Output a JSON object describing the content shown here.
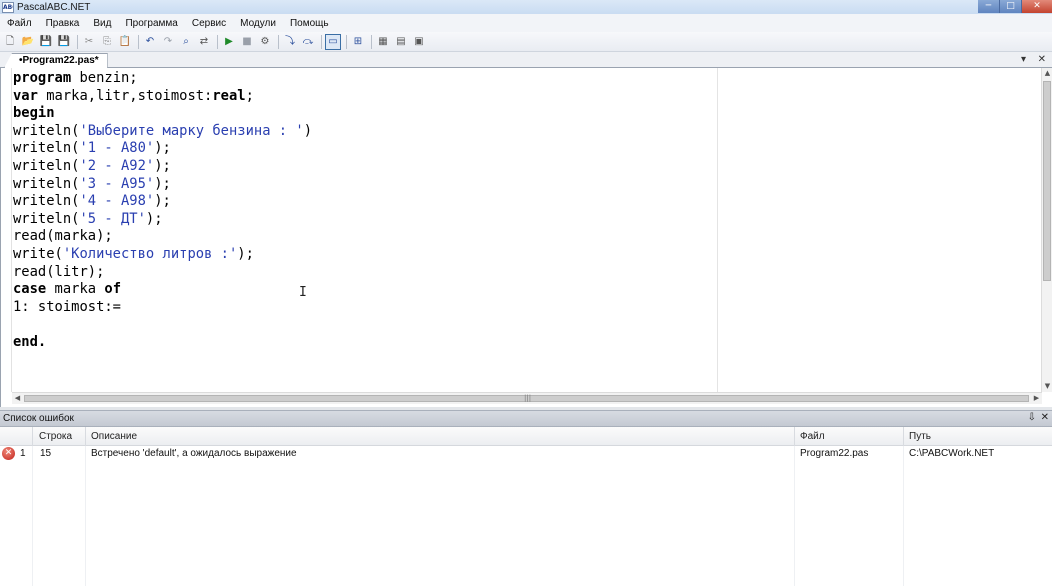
{
  "window": {
    "title": "PascalABC.NET",
    "icon_label": "ABC",
    "controls": {
      "minimize": "─",
      "maximize": "□",
      "close": "✕"
    }
  },
  "menu": {
    "items": [
      {
        "label": "Файл"
      },
      {
        "label": "Правка"
      },
      {
        "label": "Вид"
      },
      {
        "label": "Программа"
      },
      {
        "label": "Сервис"
      },
      {
        "label": "Модули"
      },
      {
        "label": "Помощь"
      }
    ]
  },
  "toolbar": {
    "icons": [
      {
        "name": "new-file-icon",
        "glyph": "🗋",
        "color": "#555555"
      },
      {
        "name": "open-file-icon",
        "glyph": "📂",
        "color": "#c9a030"
      },
      {
        "name": "save-icon",
        "glyph": "💾",
        "color": "#2b4f9c"
      },
      {
        "name": "save-all-icon",
        "glyph": "💾",
        "color": "#2b4f9c"
      },
      {
        "name": "sep"
      },
      {
        "name": "cut-icon",
        "glyph": "✂",
        "color": "#8a8a8a"
      },
      {
        "name": "copy-icon",
        "glyph": "⎘",
        "color": "#8a8a8a"
      },
      {
        "name": "paste-icon",
        "glyph": "📋",
        "color": "#b8862e"
      },
      {
        "name": "sep"
      },
      {
        "name": "undo-icon",
        "glyph": "↶",
        "color": "#2b4f9c"
      },
      {
        "name": "redo-icon",
        "glyph": "↷",
        "color": "#9aa0aa"
      },
      {
        "name": "find-icon",
        "glyph": "⌕",
        "color": "#2b4f9c"
      },
      {
        "name": "replace-icon",
        "glyph": "⇄",
        "color": "#555555"
      },
      {
        "name": "sep"
      },
      {
        "name": "run-icon",
        "glyph": "▶",
        "color": "#1f8a2a"
      },
      {
        "name": "stop-icon",
        "glyph": "■",
        "color": "#9aa0aa"
      },
      {
        "name": "compile-icon",
        "glyph": "⚙",
        "color": "#555555"
      },
      {
        "name": "sep"
      },
      {
        "name": "step-into-icon",
        "glyph": "⤵",
        "color": "#2b4f9c"
      },
      {
        "name": "step-over-icon",
        "glyph": "⤼",
        "color": "#2b4f9c"
      },
      {
        "name": "sep"
      },
      {
        "name": "output-window-icon",
        "glyph": "▭",
        "color": "#2b4f9c",
        "active": true
      },
      {
        "name": "sep"
      },
      {
        "name": "form-designer-icon",
        "glyph": "⊞",
        "color": "#2b4f9c"
      },
      {
        "name": "sep"
      },
      {
        "name": "options-icon",
        "glyph": "▦",
        "color": "#555555"
      },
      {
        "name": "help-icon",
        "glyph": "▤",
        "color": "#555555"
      },
      {
        "name": "about-icon",
        "glyph": "▣",
        "color": "#555555"
      }
    ]
  },
  "tabs": {
    "active": "•Program22.pas*",
    "close_glyph": "✕",
    "dropdown_glyph": "▾"
  },
  "editor": {
    "lines": [
      [
        {
          "t": "program",
          "k": "kw"
        },
        {
          "t": " benzin;"
        }
      ],
      [
        {
          "t": "var",
          "k": "kw"
        },
        {
          "t": " marka,litr,stoimost:"
        },
        {
          "t": "real",
          "k": "kw"
        },
        {
          "t": ";"
        }
      ],
      [
        {
          "t": "begin",
          "k": "kw"
        }
      ],
      [
        {
          "t": "writeln("
        },
        {
          "t": "'Выберите марку бензина : '",
          "k": "str"
        },
        {
          "t": ")"
        }
      ],
      [
        {
          "t": "writeln("
        },
        {
          "t": "'1 - A80'",
          "k": "str"
        },
        {
          "t": ");"
        }
      ],
      [
        {
          "t": "writeln("
        },
        {
          "t": "'2 - A92'",
          "k": "str"
        },
        {
          "t": ");"
        }
      ],
      [
        {
          "t": "writeln("
        },
        {
          "t": "'3 - A95'",
          "k": "str"
        },
        {
          "t": ");"
        }
      ],
      [
        {
          "t": "writeln("
        },
        {
          "t": "'4 - A98'",
          "k": "str"
        },
        {
          "t": ");"
        }
      ],
      [
        {
          "t": "writeln("
        },
        {
          "t": "'5 - ДТ'",
          "k": "str"
        },
        {
          "t": ");"
        }
      ],
      [
        {
          "t": "read(marka);"
        }
      ],
      [
        {
          "t": "write("
        },
        {
          "t": "'Количество литров :'",
          "k": "str"
        },
        {
          "t": ");"
        }
      ],
      [
        {
          "t": "read(litr);"
        }
      ],
      [
        {
          "t": "case",
          "k": "kw"
        },
        {
          "t": " marka "
        },
        {
          "t": "of",
          "k": "kw"
        }
      ],
      [
        {
          "t": "1: stoimost:="
        }
      ],
      [
        {
          "t": ""
        }
      ],
      [
        {
          "t": "end.",
          "k": "kw"
        }
      ]
    ],
    "caret_glyph": "I",
    "scroll": {
      "up": "▲",
      "down": "▼",
      "left": "◀",
      "right": "▶",
      "grip": "|||"
    }
  },
  "errors": {
    "panel_title": "Список ошибок",
    "pin_glyph": "⇩",
    "close_glyph": "✕",
    "columns": {
      "line": "Строка",
      "description": "Описание",
      "file": "Файл",
      "path": "Путь"
    },
    "rows": [
      {
        "icon": "✕",
        "index": "1",
        "line": "15",
        "description": "Встречено 'default', а ожидалось выражение",
        "file": "Program22.pas",
        "path": "C:\\PABCWork.NET"
      }
    ]
  }
}
